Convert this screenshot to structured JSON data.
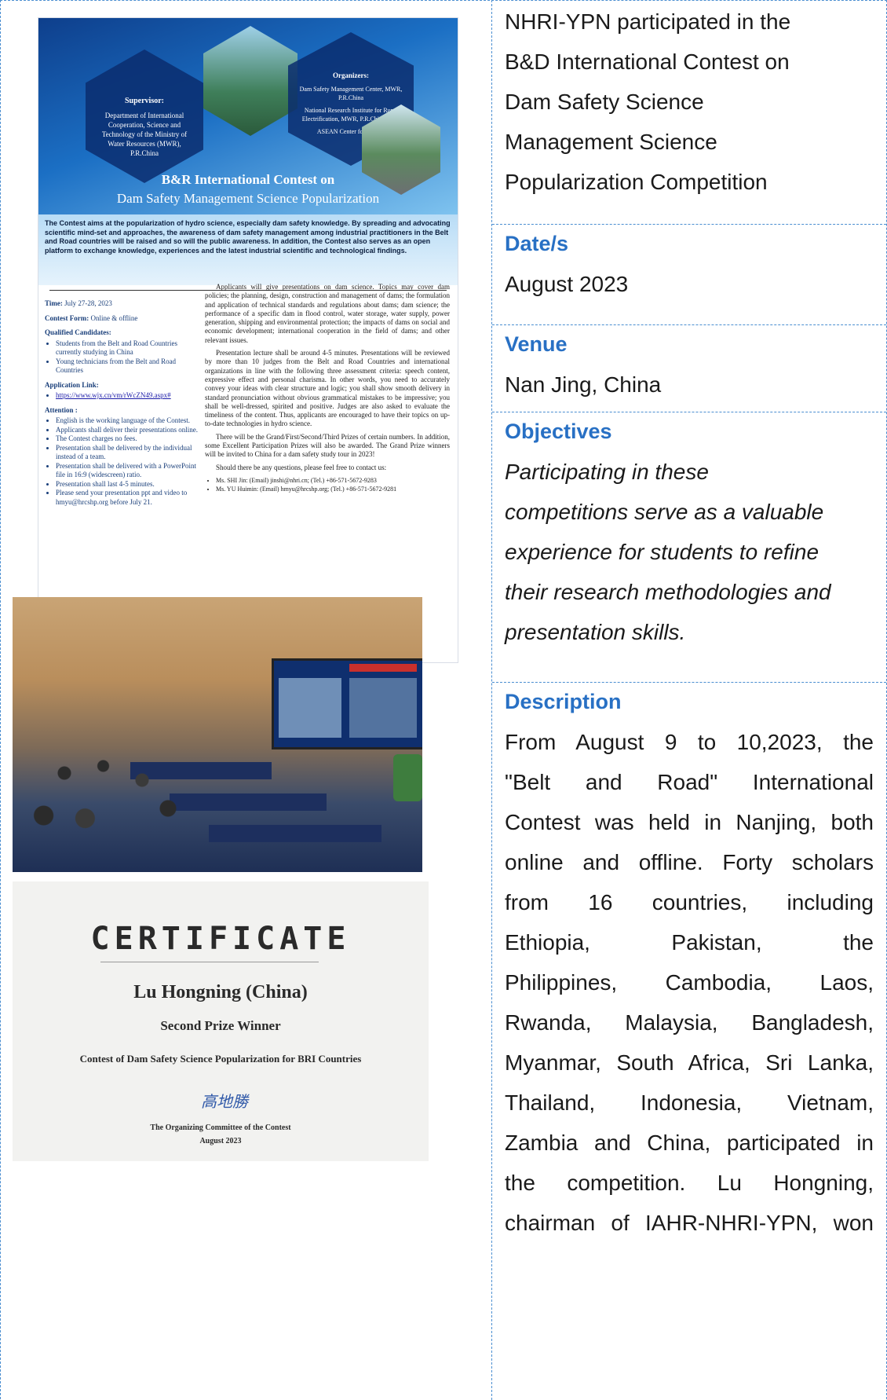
{
  "poster": {
    "supervisor_heading": "Supervisor:",
    "supervisor_text": "Department of International Cooperation, Science and Technology of the Ministry of Water Resources (MWR), P.R.China",
    "organizers_heading": "Organizers:",
    "organizers_text_1": "Dam Safety Management Center, MWR, P.R.China",
    "organizers_text_2": "National Research Institute for Rural Electrification, MWR, P.R.China/HRC",
    "organizers_text_3": "ASEAN Center for Energy",
    "title_line_1": "B&R International Contest on",
    "title_line_2": "Dam Safety Management Science Popularization",
    "intro": "The Contest aims at the popularization of hydro science, especially dam safety knowledge. By spreading and advocating scientific mind-set and approaches, the awareness of dam safety management among industrial practitioners in the Belt and Road countries will be raised and so will the public awareness. In addition, the Contest also serves as an open platform to exchange knowledge, experiences and the latest industrial scientific and technological findings.",
    "time_label": "Time:",
    "time_value": "July 27-28, 2023",
    "form_label": "Contest Form:",
    "form_value": "Online & offline",
    "qualified_heading": "Qualified Candidates:",
    "qualified_items": [
      "Students from the Belt and Road Countries currently studying in China",
      "Young technicians from the Belt and Road Countries"
    ],
    "application_heading": "Application Link:",
    "application_link": "https://www.wjx.cn/vm/rWcZN49.aspx#",
    "attention_heading": "Attention :",
    "attention_items": [
      "English is the working language of the Contest.",
      "Applicants shall deliver their presentations online.",
      "The Contest charges no fees.",
      "Presentation shall be delivered by the individual instead of a team.",
      "Presentation shall be delivered with a PowerPoint file in 16:9 (widescreen) ratio.",
      "Presentation shall last 4-5 minutes.",
      "Please send your presentation ppt and video to hmyu@hrcshp.org before July 21."
    ],
    "para_1": "Applicants will give presentations on dam science. Topics may cover dam policies; the planning, design, construction and management of dams; the formulation and application of technical standards and regulations about dams; dam science; the performance of a specific dam in flood control, water storage, water supply, power generation, shipping and environmental protection; the impacts of dams on social and economic development; international cooperation in the field of dams; and other relevant issues.",
    "para_2": "Presentation lecture shall be around 4-5 minutes. Presentations will be reviewed by more than 10 judges from the Belt and Road Countries and international organizations in line with the following three assessment criteria: speech content, expressive effect and personal charisma. In other words, you need to accurately convey your ideas with clear structure and logic; you shall show smooth delivery in standard pronunciation without obvious grammatical mistakes to be impressive; you shall be well-dressed, spirited and positive. Judges are also asked to evaluate the timeliness of the content. Thus, applicants are encouraged to have their topics on up-to-date technologies in hydro science.",
    "para_3": "There will be the Grand/First/Second/Third Prizes of certain numbers. In addition, some Excellent Participation Prizes will also be awarded. The Grand Prize winners will be invited to China for a dam safety study tour in 2023!",
    "contact_intro": "Should there be any questions, please feel free to contact us:",
    "contact_1": "Ms. SHI Jin: (Email) jinshi@nhri.cn; (Tel.) +86-571-5672-9283",
    "contact_2": "Ms. YU Huimin: (Email) hmyu@hrcshp.org; (Tel.) +86-571-5672-9281"
  },
  "certificate": {
    "title": "CERTIFICATE",
    "name": "Lu Hongning (China)",
    "prize": "Second Prize Winner",
    "contest": "Contest of Dam Safety Science Popularization for BRI Countries",
    "signature": "高地勝",
    "committee": "The Organizing Committee of the Contest",
    "date": "August  2023"
  },
  "right": {
    "title_lines": [
      "NHRI-YPN participated in the",
      "B&D International Contest on",
      "Dam Safety Science",
      "Management Science",
      "Popularization Competition"
    ],
    "date_heading": "Date/s",
    "date_value": "August 2023",
    "venue_heading": "Venue",
    "venue_value": "Nan Jing, China",
    "objectives_heading": "Objectives",
    "objectives_lines": [
      "Participating in these",
      "competitions serve as a valuable",
      "experience for students to refine",
      "their research methodologies and",
      "presentation skills."
    ],
    "description_heading": "Description",
    "description_lines": [
      "From August 9 to 10,2023, the",
      "\"Belt and Road\" International",
      "Contest was held in Nanjing, both",
      "online and offline. Forty scholars",
      "from 16 countries, including",
      "Ethiopia, Pakistan, the",
      "Philippines, Cambodia, Laos,",
      "Rwanda, Malaysia, Bangladesh,",
      "Myanmar, South Africa, Sri Lanka,",
      "Thailand, Indonesia, Vietnam,",
      "Zambia and China, participated in",
      "the competition. Lu Hongning,",
      "chairman of IAHR-NHRI-YPN, won"
    ]
  }
}
